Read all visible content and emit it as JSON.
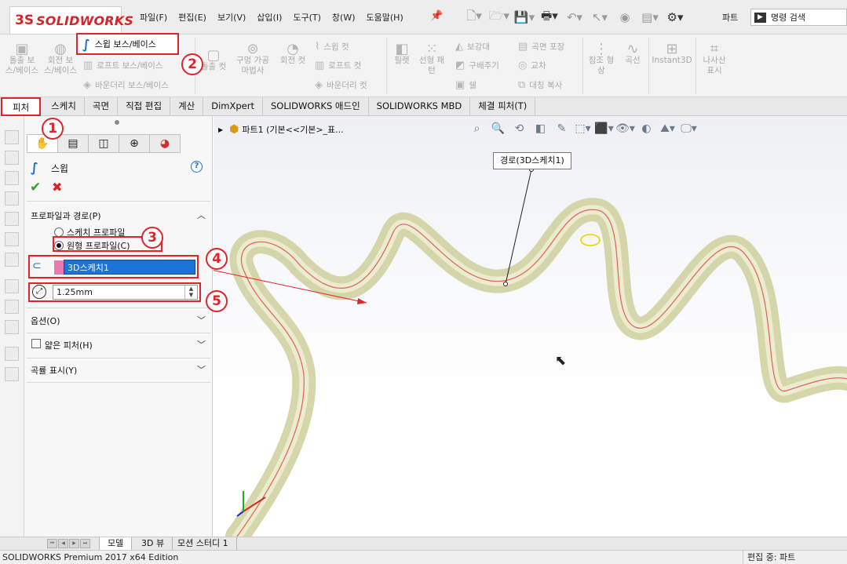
{
  "app": {
    "logo_text": "SOLIDWORKS",
    "menus": [
      "파일(F)",
      "편집(E)",
      "보기(V)",
      "삽입(I)",
      "도구(T)",
      "창(W)",
      "도움말(H)"
    ],
    "document_type": "파트",
    "search_placeholder": "명령 검색"
  },
  "ribbon": {
    "sweep": "스윕 보스/베이스",
    "extrude_boss": "돌출 보스/베이스",
    "revolve_boss": "회전 보스/베이스",
    "loft_boss": "로프트 보스/베이스",
    "boundary_boss": "바운더리 보스/베이스",
    "extrude_cut": "돌출 컷",
    "hole_wizard": "구멍 가공 마법사",
    "revolve_cut": "회전 컷",
    "swept_cut": "스윕 컷",
    "lofted_cut": "로프트 컷",
    "boundary_cut": "바운더리 컷",
    "fillet": "필렛",
    "linear_pattern": "선형 패턴",
    "rib": "보강대",
    "draft": "구배주기",
    "shell": "쉘",
    "wrap": "곡면 포장",
    "intersect": "교차",
    "mirror": "대칭 복사",
    "reference_geometry": "참조 형상",
    "curves": "곡선",
    "instant3d": "Instant3D",
    "thread_display": "나사산 표시"
  },
  "command_tabs": [
    "피처",
    "스케치",
    "곡면",
    "직접 편집",
    "계산",
    "DimXpert",
    "SOLIDWORKS 애드인",
    "SOLIDWORKS MBD",
    "체결 피처(T)"
  ],
  "property_manager": {
    "title": "스윕",
    "group_profile_path": "프로파일과 경로(P)",
    "radio_sketch_profile": "스케치 프로파일",
    "radio_circular_profile": "원형 프로파일(C)",
    "path_value": "3D스케치1",
    "diameter_value": "1.25mm",
    "group_options": "옵션(O)",
    "thin_feature": "얇은 피처(H)",
    "curvature_display": "곡률 표시(Y)"
  },
  "callouts": [
    "1",
    "2",
    "3",
    "4",
    "5"
  ],
  "viewport": {
    "tree_title": "파트1  (기본<<기본>_표...",
    "path_label": "경로(3D스케치1)"
  },
  "bottom_tabs": [
    "모델",
    "3D 뷰",
    "모션 스터디 1"
  ],
  "status": {
    "left": "SOLIDWORKS Premium 2017 x64 Edition",
    "right": "편집 중: 파트"
  },
  "colors": {
    "brand_red": "#d5252c",
    "callout_red": "#e0242a",
    "selection_blue": "#1b74d6",
    "sweep_tube": "#d8d7a8",
    "path_line": "#e05a5a"
  }
}
